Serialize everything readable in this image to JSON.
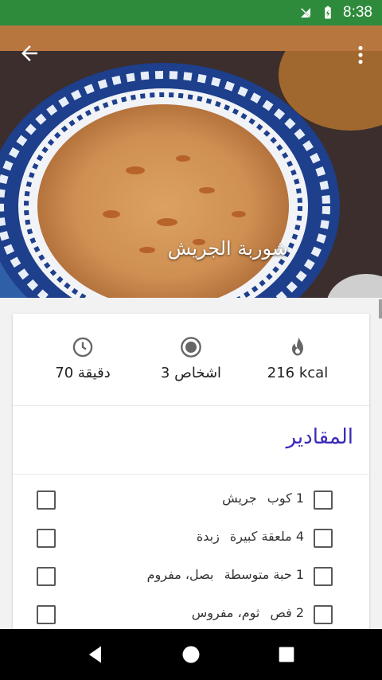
{
  "status_bar": {
    "time": "8:38",
    "icons": [
      "no-sim-icon",
      "battery-charging-icon"
    ],
    "color": "#2e8b3c"
  },
  "hero": {
    "title": "شوربة الجريش",
    "back_icon": "arrow-back-icon",
    "more_icon": "more-vert-icon"
  },
  "stats": {
    "time": {
      "icon": "clock-icon",
      "label": "70 دقيقة"
    },
    "servings": {
      "icon": "radio-circle-icon",
      "label": "3 اشخاص"
    },
    "calories": {
      "icon": "flame-icon",
      "label": "216 kcal"
    }
  },
  "ingredients": {
    "title": "المقادير",
    "title_color": "#3a2bb8",
    "items": [
      {
        "qty": "1 كوب",
        "name": "جريش"
      },
      {
        "qty": "4 ملعقة كبيرة",
        "name": "زبدة"
      },
      {
        "qty": "1 حبة متوسطة",
        "name": "بصل، مفروم"
      },
      {
        "qty": "2 فص",
        "name": "ثوم، مفروس"
      }
    ]
  },
  "nav_bar": {
    "icons": [
      "nav-back-icon",
      "nav-home-icon",
      "nav-recents-icon"
    ]
  }
}
